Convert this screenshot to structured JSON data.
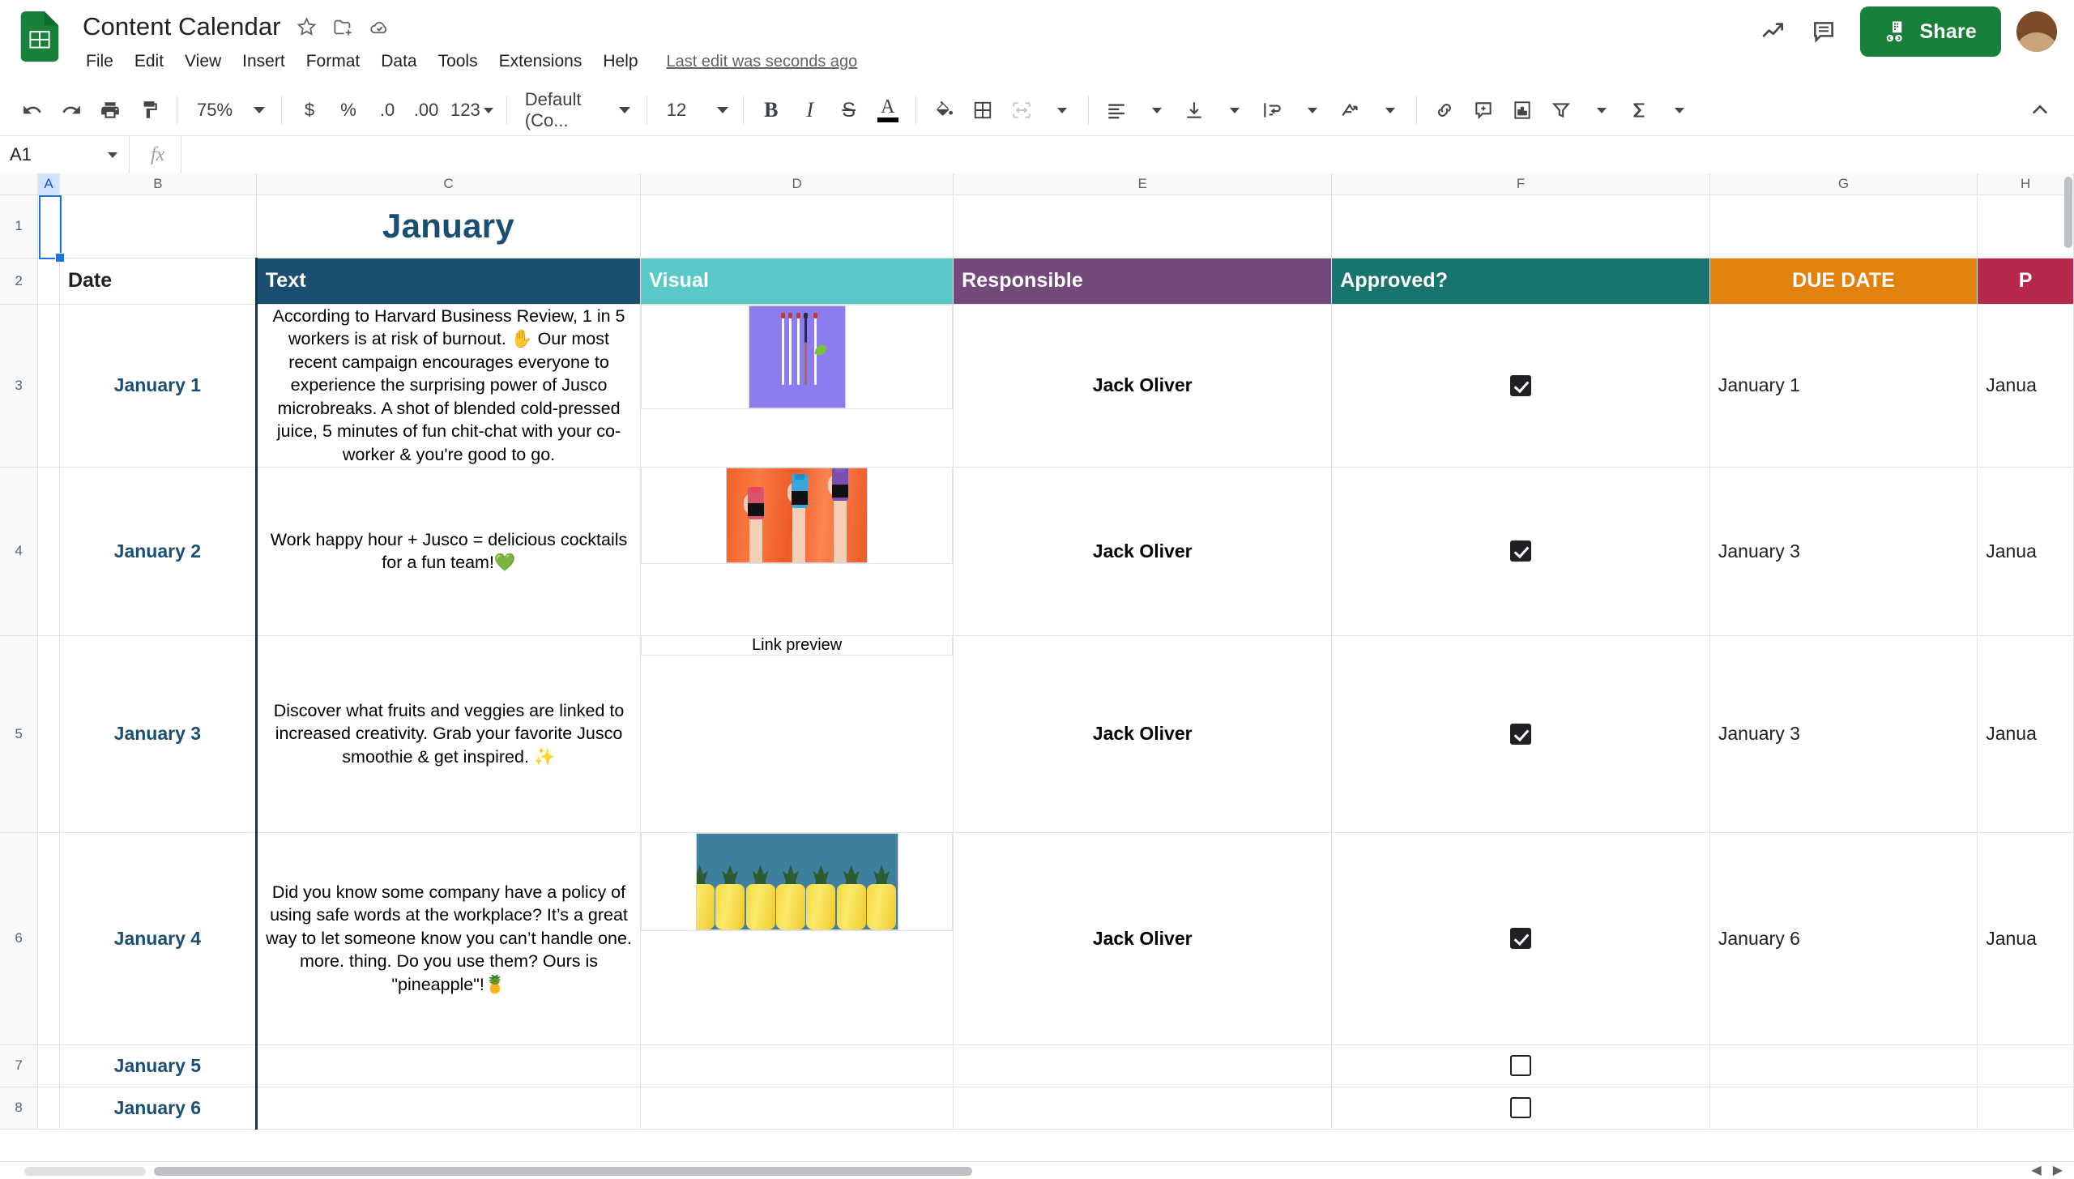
{
  "app": {
    "doc_title": "Content Calendar",
    "last_edit": "Last edit was seconds ago",
    "share_label": "Share"
  },
  "menus": [
    "File",
    "Edit",
    "View",
    "Insert",
    "Format",
    "Data",
    "Tools",
    "Extensions",
    "Help"
  ],
  "title_icons": [
    "star-icon",
    "move-to-folder-icon",
    "cloud-saved-icon"
  ],
  "top_right_icons": [
    "trending-up-icon",
    "comment-icon"
  ],
  "toolbar": {
    "zoom": "75%",
    "currency": "$",
    "percent": "%",
    "decrease_decimal": ".0",
    "increase_decimal": ".00",
    "number_format": "123",
    "font": "Default (Co...",
    "font_size": "12",
    "bold": "B",
    "italic": "I",
    "strikethrough": "S",
    "text_color": "A",
    "icons": [
      "undo-icon",
      "redo-icon",
      "print-icon",
      "paint-format-icon",
      "fill-color-icon",
      "borders-icon",
      "merge-cells-icon",
      "horizontal-align-icon",
      "vertical-align-icon",
      "text-wrap-icon",
      "text-rotation-icon",
      "insert-link-icon",
      "insert-comment-icon",
      "insert-chart-icon",
      "create-filter-icon",
      "functions-icon",
      "collapse-toolbar-icon"
    ]
  },
  "formula_bar": {
    "name_box": "A1",
    "fx_label": "fx",
    "formula_value": ""
  },
  "grid": {
    "column_headers": [
      "A",
      "B",
      "C",
      "D",
      "E",
      "F",
      "G",
      "H"
    ],
    "selected_column": "A",
    "row_headers": [
      "1",
      "2",
      "3",
      "4",
      "5",
      "6",
      "7",
      "8"
    ],
    "sheet_title": "January",
    "headers": {
      "date": "Date",
      "text": "Text",
      "visual": "Visual",
      "responsible": "Responsible",
      "approved": "Approved?",
      "due_date": "DUE DATE",
      "publish": "P"
    },
    "header_colors": {
      "text": "#1b4f72",
      "visual": "#5ac8c8",
      "responsible": "#74487a",
      "approved": "#17756e",
      "due_date": "#e2820d",
      "publish": "#b5294b",
      "title": "#1b4f72"
    },
    "rows": [
      {
        "row_num": "3",
        "date": "January 1",
        "text": "According to Harvard Business Review, 1 in 5 workers is at risk of burnout. ✋ Our most recent campaign encourages everyone to experience the surprising power of Jusco microbreaks. A shot of blended cold-pressed juice, 5 minutes of fun chit-chat with your co-worker & you're good to go.",
        "visual_type": "image-matchsticks",
        "visual_label": "",
        "responsible": "Jack Oliver",
        "approved": true,
        "due_date": "January 1",
        "publish": "Janua"
      },
      {
        "row_num": "4",
        "date": "January 2",
        "text": "Work happy hour + Jusco = delicious cocktails for a fun team!💚",
        "visual_type": "image-bottles",
        "visual_label": "",
        "responsible": "Jack Oliver",
        "approved": true,
        "due_date": "January 3",
        "publish": "Janua"
      },
      {
        "row_num": "5",
        "date": "January 3",
        "text": "Discover what fruits and veggies are linked to increased creativity. Grab your favorite Jusco smoothie & get inspired. ✨",
        "visual_type": "link-preview",
        "visual_label": "Link preview",
        "responsible": "Jack Oliver",
        "approved": true,
        "due_date": "January 3",
        "publish": "Janua"
      },
      {
        "row_num": "6",
        "date": "January 4",
        "text": "Did you know some company have a policy of using safe words at the workplace? It’s a great way to let someone know you can’t handle one. more. thing. Do you use them? Ours is \"pineapple\"!🍍",
        "visual_type": "image-pineapples",
        "visual_label": "",
        "responsible": "Jack Oliver",
        "approved": true,
        "due_date": "January 6",
        "publish": "Janua"
      },
      {
        "row_num": "7",
        "date": "January 5",
        "text": "",
        "visual_type": "none",
        "visual_label": "",
        "responsible": "",
        "approved": false,
        "due_date": "",
        "publish": ""
      },
      {
        "row_num": "8",
        "date": "January 6",
        "text": "",
        "visual_type": "none",
        "visual_label": "",
        "responsible": "",
        "approved": false,
        "due_date": "",
        "publish": ""
      }
    ]
  }
}
